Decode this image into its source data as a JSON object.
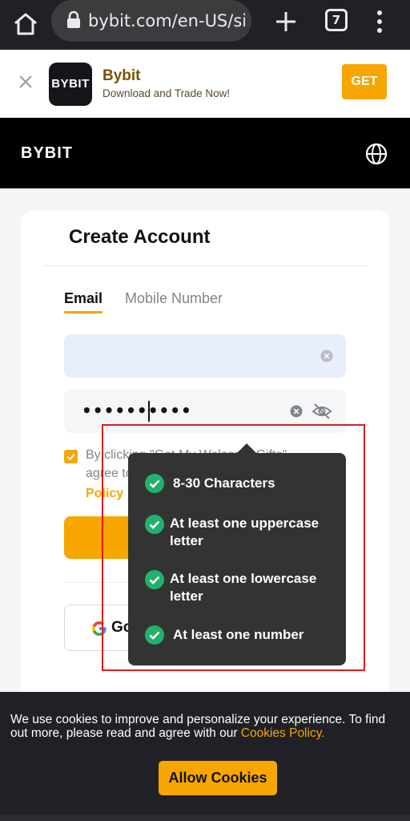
{
  "browser": {
    "url": "bybit.com/en-US/sig",
    "tab_count": "7"
  },
  "app_banner": {
    "logo_text": "BYBIT",
    "name": "Bybit",
    "subtitle": "Download and Trade Now!",
    "get_label": "GET"
  },
  "site_header": {
    "logo_text": "BYBIT"
  },
  "form": {
    "title": "Create Account",
    "tabs": [
      {
        "label": "Email",
        "active": true
      },
      {
        "label": "Mobile Number",
        "active": false
      }
    ],
    "email_value": "",
    "password_value": "••••••••••",
    "agree_line1": "By clicking \"Get My Welcome Gifts\"",
    "agree_line2": "agree to",
    "agree_link": "Policy",
    "google_label": "Go"
  },
  "password_requirements": [
    {
      "text": "8-30 Characters",
      "met": true
    },
    {
      "text": "At least one uppercase letter",
      "line1": "At least one uppercase",
      "line2": "letter",
      "met": true
    },
    {
      "text": "At least one lowercase letter",
      "line1": "At least one lowercase",
      "line2": "letter",
      "met": true
    },
    {
      "text": "At least one number",
      "met": true
    }
  ],
  "cookie_banner": {
    "text": "We use cookies to improve and personalize your experience. To find out more, please read and agree with our ",
    "link": "Cookies Policy.",
    "allow_label": "Allow Cookies"
  },
  "colors": {
    "accent": "#f7a600",
    "check_green": "#20b26c",
    "highlight_red": "#e01c1c"
  }
}
